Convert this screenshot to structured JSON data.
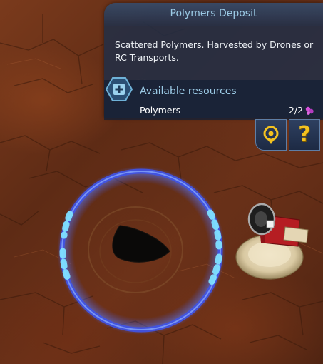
{
  "panel": {
    "title": "Polymers Deposit",
    "description": "Scattered Polymers. Harvested by Drones or RC Transports.",
    "resources": {
      "heading": "Available resources",
      "items": [
        {
          "name": "Polymers",
          "amount": "2/2",
          "icon": "polymers-icon"
        }
      ]
    }
  },
  "buttons": {
    "locate": {
      "icon": "locate-target-icon"
    },
    "help": {
      "label": "?",
      "icon": "help-icon"
    }
  },
  "colors": {
    "panel_bg": "#222e46",
    "accent_text": "#9ccbe6",
    "ring_blue": "#4a7cff",
    "help_yellow": "#f4c21f",
    "polymer_magenta": "#d64fd8"
  }
}
